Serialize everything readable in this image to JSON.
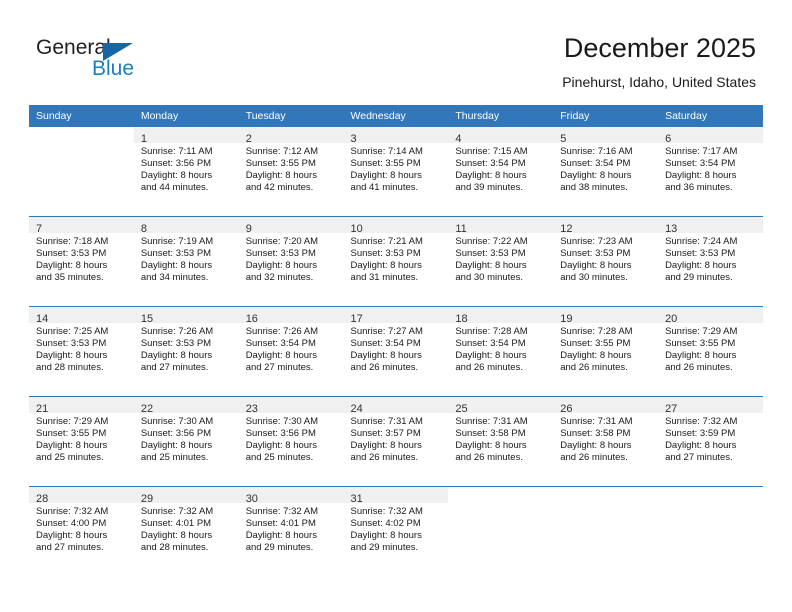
{
  "brand": {
    "name_dark": "General",
    "name_blue": "Blue",
    "accent_color": "#1a7fc1",
    "triangle_color": "#1566a8"
  },
  "header": {
    "title": "December 2025",
    "subtitle": "Pinehurst, Idaho, United States"
  },
  "calendar": {
    "header_bg": "#3377bb",
    "daynum_bg": "#f0f0f0",
    "weekdays": [
      "Sunday",
      "Monday",
      "Tuesday",
      "Wednesday",
      "Thursday",
      "Friday",
      "Saturday"
    ],
    "weeks": [
      [
        {
          "day": "",
          "sunrise": "",
          "sunset": "",
          "daylight1": "",
          "daylight2": ""
        },
        {
          "day": "1",
          "sunrise": "Sunrise: 7:11 AM",
          "sunset": "Sunset: 3:56 PM",
          "daylight1": "Daylight: 8 hours",
          "daylight2": "and 44 minutes."
        },
        {
          "day": "2",
          "sunrise": "Sunrise: 7:12 AM",
          "sunset": "Sunset: 3:55 PM",
          "daylight1": "Daylight: 8 hours",
          "daylight2": "and 42 minutes."
        },
        {
          "day": "3",
          "sunrise": "Sunrise: 7:14 AM",
          "sunset": "Sunset: 3:55 PM",
          "daylight1": "Daylight: 8 hours",
          "daylight2": "and 41 minutes."
        },
        {
          "day": "4",
          "sunrise": "Sunrise: 7:15 AM",
          "sunset": "Sunset: 3:54 PM",
          "daylight1": "Daylight: 8 hours",
          "daylight2": "and 39 minutes."
        },
        {
          "day": "5",
          "sunrise": "Sunrise: 7:16 AM",
          "sunset": "Sunset: 3:54 PM",
          "daylight1": "Daylight: 8 hours",
          "daylight2": "and 38 minutes."
        },
        {
          "day": "6",
          "sunrise": "Sunrise: 7:17 AM",
          "sunset": "Sunset: 3:54 PM",
          "daylight1": "Daylight: 8 hours",
          "daylight2": "and 36 minutes."
        }
      ],
      [
        {
          "day": "7",
          "sunrise": "Sunrise: 7:18 AM",
          "sunset": "Sunset: 3:53 PM",
          "daylight1": "Daylight: 8 hours",
          "daylight2": "and 35 minutes."
        },
        {
          "day": "8",
          "sunrise": "Sunrise: 7:19 AM",
          "sunset": "Sunset: 3:53 PM",
          "daylight1": "Daylight: 8 hours",
          "daylight2": "and 34 minutes."
        },
        {
          "day": "9",
          "sunrise": "Sunrise: 7:20 AM",
          "sunset": "Sunset: 3:53 PM",
          "daylight1": "Daylight: 8 hours",
          "daylight2": "and 32 minutes."
        },
        {
          "day": "10",
          "sunrise": "Sunrise: 7:21 AM",
          "sunset": "Sunset: 3:53 PM",
          "daylight1": "Daylight: 8 hours",
          "daylight2": "and 31 minutes."
        },
        {
          "day": "11",
          "sunrise": "Sunrise: 7:22 AM",
          "sunset": "Sunset: 3:53 PM",
          "daylight1": "Daylight: 8 hours",
          "daylight2": "and 30 minutes."
        },
        {
          "day": "12",
          "sunrise": "Sunrise: 7:23 AM",
          "sunset": "Sunset: 3:53 PM",
          "daylight1": "Daylight: 8 hours",
          "daylight2": "and 30 minutes."
        },
        {
          "day": "13",
          "sunrise": "Sunrise: 7:24 AM",
          "sunset": "Sunset: 3:53 PM",
          "daylight1": "Daylight: 8 hours",
          "daylight2": "and 29 minutes."
        }
      ],
      [
        {
          "day": "14",
          "sunrise": "Sunrise: 7:25 AM",
          "sunset": "Sunset: 3:53 PM",
          "daylight1": "Daylight: 8 hours",
          "daylight2": "and 28 minutes."
        },
        {
          "day": "15",
          "sunrise": "Sunrise: 7:26 AM",
          "sunset": "Sunset: 3:53 PM",
          "daylight1": "Daylight: 8 hours",
          "daylight2": "and 27 minutes."
        },
        {
          "day": "16",
          "sunrise": "Sunrise: 7:26 AM",
          "sunset": "Sunset: 3:54 PM",
          "daylight1": "Daylight: 8 hours",
          "daylight2": "and 27 minutes."
        },
        {
          "day": "17",
          "sunrise": "Sunrise: 7:27 AM",
          "sunset": "Sunset: 3:54 PM",
          "daylight1": "Daylight: 8 hours",
          "daylight2": "and 26 minutes."
        },
        {
          "day": "18",
          "sunrise": "Sunrise: 7:28 AM",
          "sunset": "Sunset: 3:54 PM",
          "daylight1": "Daylight: 8 hours",
          "daylight2": "and 26 minutes."
        },
        {
          "day": "19",
          "sunrise": "Sunrise: 7:28 AM",
          "sunset": "Sunset: 3:55 PM",
          "daylight1": "Daylight: 8 hours",
          "daylight2": "and 26 minutes."
        },
        {
          "day": "20",
          "sunrise": "Sunrise: 7:29 AM",
          "sunset": "Sunset: 3:55 PM",
          "daylight1": "Daylight: 8 hours",
          "daylight2": "and 26 minutes."
        }
      ],
      [
        {
          "day": "21",
          "sunrise": "Sunrise: 7:29 AM",
          "sunset": "Sunset: 3:55 PM",
          "daylight1": "Daylight: 8 hours",
          "daylight2": "and 25 minutes."
        },
        {
          "day": "22",
          "sunrise": "Sunrise: 7:30 AM",
          "sunset": "Sunset: 3:56 PM",
          "daylight1": "Daylight: 8 hours",
          "daylight2": "and 25 minutes."
        },
        {
          "day": "23",
          "sunrise": "Sunrise: 7:30 AM",
          "sunset": "Sunset: 3:56 PM",
          "daylight1": "Daylight: 8 hours",
          "daylight2": "and 25 minutes."
        },
        {
          "day": "24",
          "sunrise": "Sunrise: 7:31 AM",
          "sunset": "Sunset: 3:57 PM",
          "daylight1": "Daylight: 8 hours",
          "daylight2": "and 26 minutes."
        },
        {
          "day": "25",
          "sunrise": "Sunrise: 7:31 AM",
          "sunset": "Sunset: 3:58 PM",
          "daylight1": "Daylight: 8 hours",
          "daylight2": "and 26 minutes."
        },
        {
          "day": "26",
          "sunrise": "Sunrise: 7:31 AM",
          "sunset": "Sunset: 3:58 PM",
          "daylight1": "Daylight: 8 hours",
          "daylight2": "and 26 minutes."
        },
        {
          "day": "27",
          "sunrise": "Sunrise: 7:32 AM",
          "sunset": "Sunset: 3:59 PM",
          "daylight1": "Daylight: 8 hours",
          "daylight2": "and 27 minutes."
        }
      ],
      [
        {
          "day": "28",
          "sunrise": "Sunrise: 7:32 AM",
          "sunset": "Sunset: 4:00 PM",
          "daylight1": "Daylight: 8 hours",
          "daylight2": "and 27 minutes."
        },
        {
          "day": "29",
          "sunrise": "Sunrise: 7:32 AM",
          "sunset": "Sunset: 4:01 PM",
          "daylight1": "Daylight: 8 hours",
          "daylight2": "and 28 minutes."
        },
        {
          "day": "30",
          "sunrise": "Sunrise: 7:32 AM",
          "sunset": "Sunset: 4:01 PM",
          "daylight1": "Daylight: 8 hours",
          "daylight2": "and 29 minutes."
        },
        {
          "day": "31",
          "sunrise": "Sunrise: 7:32 AM",
          "sunset": "Sunset: 4:02 PM",
          "daylight1": "Daylight: 8 hours",
          "daylight2": "and 29 minutes."
        },
        {
          "day": "",
          "sunrise": "",
          "sunset": "",
          "daylight1": "",
          "daylight2": ""
        },
        {
          "day": "",
          "sunrise": "",
          "sunset": "",
          "daylight1": "",
          "daylight2": ""
        },
        {
          "day": "",
          "sunrise": "",
          "sunset": "",
          "daylight1": "",
          "daylight2": ""
        }
      ]
    ]
  }
}
